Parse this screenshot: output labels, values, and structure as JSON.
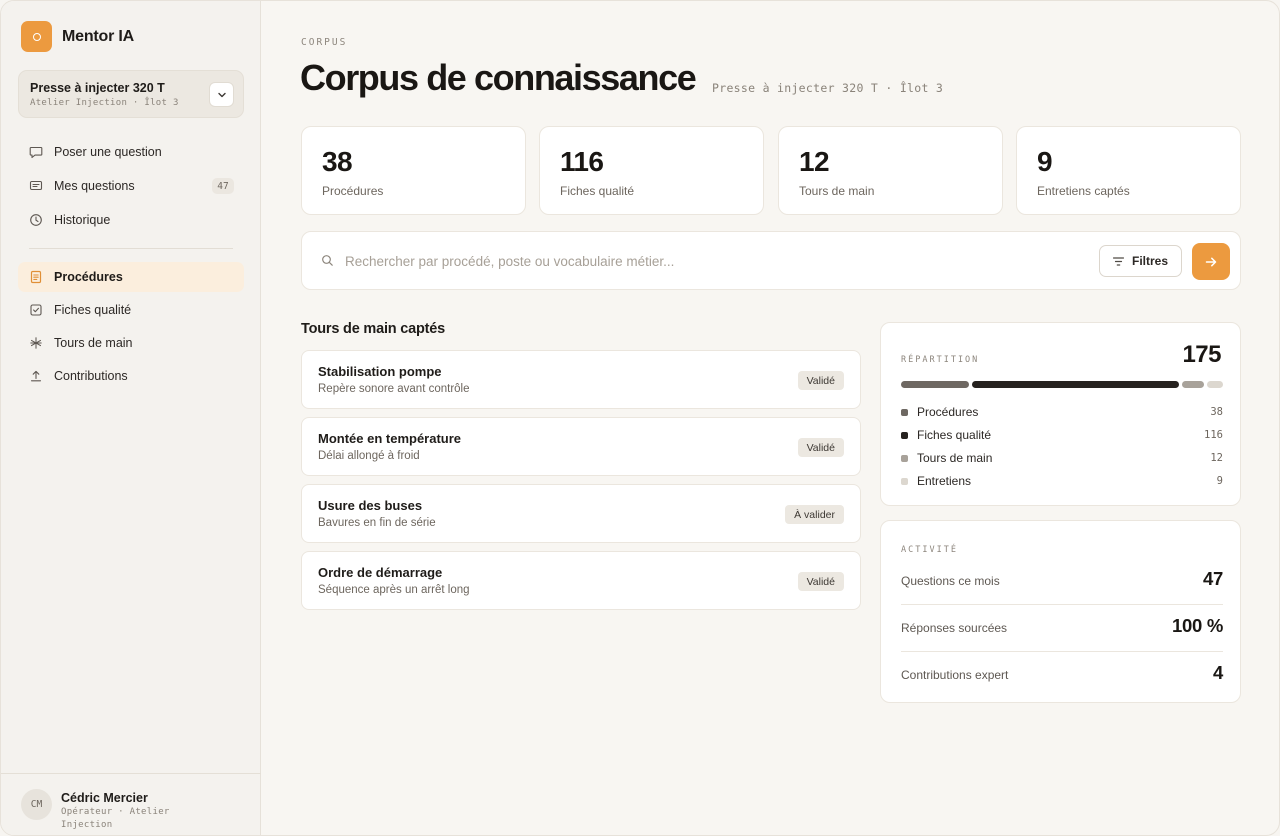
{
  "app": {
    "name": "Mentor IA",
    "accent": "#ec9a3f"
  },
  "machine": {
    "title": "Presse à injecter 320 T",
    "subtitle": "Atelier Injection · Îlot 3"
  },
  "nav": {
    "primary": [
      {
        "label": "Poser une question",
        "icon": "chat-bubble-icon"
      },
      {
        "label": "Mes questions",
        "icon": "message-square-icon",
        "badge": "47"
      },
      {
        "label": "Historique",
        "icon": "clock-icon"
      }
    ],
    "secondary": [
      {
        "label": "Procédures",
        "icon": "document-icon",
        "active": true
      },
      {
        "label": "Fiches qualité",
        "icon": "checkbox-icon"
      },
      {
        "label": "Tours de main",
        "icon": "asterisk-icon"
      },
      {
        "label": "Contributions",
        "icon": "upload-icon"
      }
    ]
  },
  "user": {
    "initials": "CM",
    "name": "Cédric Mercier",
    "role": "Opérateur · Atelier Injection"
  },
  "header": {
    "eyebrow": "CORPUS",
    "title": "Corpus de connaissance",
    "subtitle": "Presse à injecter 320 T · Îlot 3"
  },
  "stats": [
    {
      "value": "38",
      "label": "Procédures"
    },
    {
      "value": "116",
      "label": "Fiches qualité"
    },
    {
      "value": "12",
      "label": "Tours de main"
    },
    {
      "value": "9",
      "label": "Entretiens captés"
    }
  ],
  "search": {
    "placeholder": "Rechercher par procédé, poste ou vocabulaire métier...",
    "value": "",
    "filter_label": "Filtres"
  },
  "tours": {
    "title": "Tours de main captés",
    "items": [
      {
        "title": "Stabilisation pompe",
        "subtitle": "Repère sonore avant contrôle",
        "status": "Validé"
      },
      {
        "title": "Montée en température",
        "subtitle": "Délai allongé à froid",
        "status": "Validé"
      },
      {
        "title": "Usure des buses",
        "subtitle": "Bavures en fin de série",
        "status": "À valider"
      },
      {
        "title": "Ordre de démarrage",
        "subtitle": "Séquence après un arrêt long",
        "status": "Validé"
      }
    ]
  },
  "repartition": {
    "eyebrow": "RÉPARTITION",
    "total": "175",
    "items": [
      {
        "label": "Procédures",
        "value": 38,
        "color": "#6e6862"
      },
      {
        "label": "Fiches qualité",
        "value": 116,
        "color": "#26221f"
      },
      {
        "label": "Tours de main",
        "value": 12,
        "color": "#a8a29a"
      },
      {
        "label": "Entretiens",
        "value": 9,
        "color": "#dcd7cf"
      }
    ]
  },
  "activite": {
    "eyebrow": "ACTIVITÉ",
    "rows": [
      {
        "label": "Questions ce mois",
        "value": "47"
      },
      {
        "label": "Réponses sourcées",
        "value": "100 %"
      },
      {
        "label": "Contributions expert",
        "value": "4"
      }
    ]
  }
}
